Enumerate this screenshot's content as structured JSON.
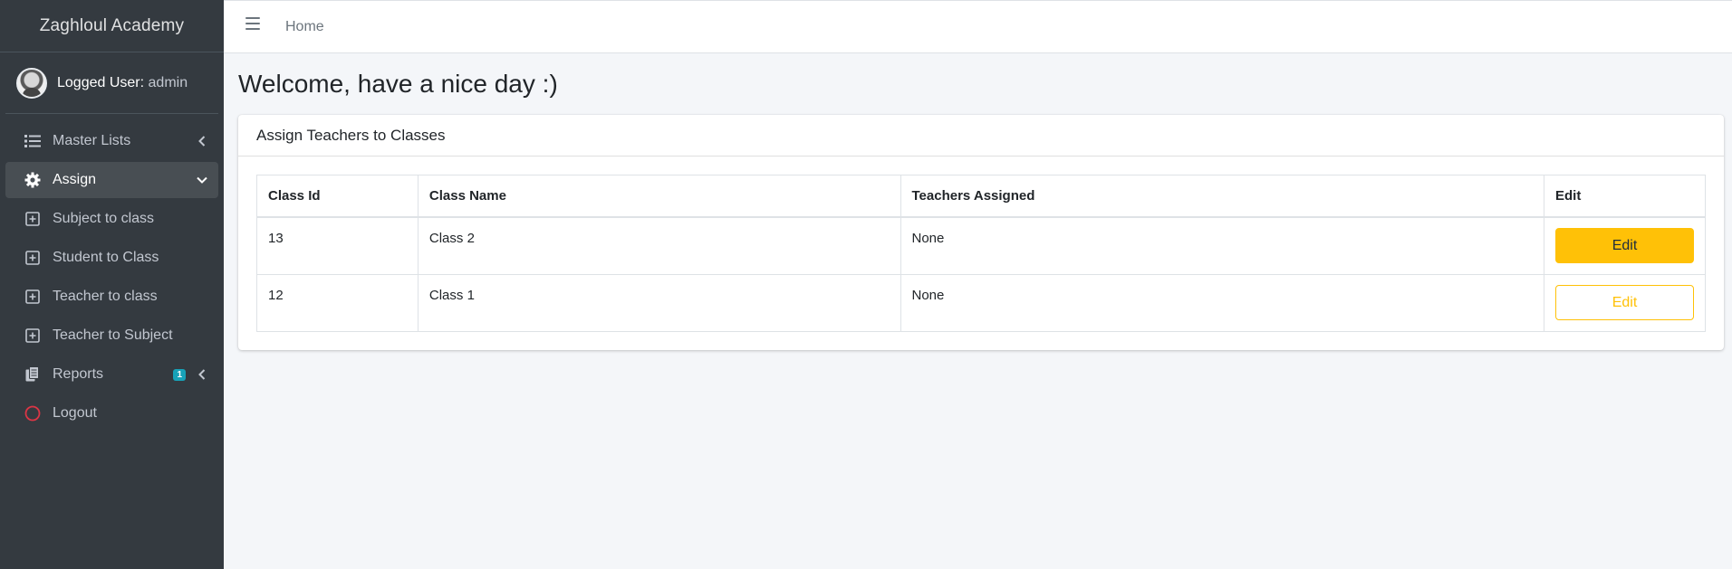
{
  "sidebar": {
    "brand": "Zaghloul Academy",
    "user": {
      "prefix": "Logged User:",
      "name": "admin"
    },
    "items": [
      {
        "label": "Master Lists",
        "icon": "list-icon"
      },
      {
        "label": "Assign",
        "icon": "gear-icon"
      },
      {
        "label": "Subject to class",
        "icon": "plus-square-icon"
      },
      {
        "label": "Student to Class",
        "icon": "plus-square-icon"
      },
      {
        "label": "Teacher to class",
        "icon": "plus-square-icon"
      },
      {
        "label": "Teacher to Subject",
        "icon": "plus-square-icon"
      },
      {
        "label": "Reports",
        "icon": "copy-icon",
        "badge": "1"
      },
      {
        "label": "Logout",
        "icon": "circle-icon"
      }
    ]
  },
  "topbar": {
    "breadcrumb": "Home"
  },
  "main": {
    "title": "Welcome, have a nice day :)",
    "card_title": "Assign Teachers to Classes",
    "table": {
      "headers": [
        "Class Id",
        "Class Name",
        "Teachers Assigned",
        "Edit"
      ],
      "rows": [
        {
          "id": "13",
          "name": "Class 2",
          "teachers": "None",
          "edit": "Edit"
        },
        {
          "id": "12",
          "name": "Class 1",
          "teachers": "None",
          "edit": "Edit"
        }
      ]
    }
  },
  "colors": {
    "sidebar_bg": "#343a40",
    "warning": "#ffc107",
    "badge": "#17a2b8",
    "logout_icon": "#dc3545"
  }
}
